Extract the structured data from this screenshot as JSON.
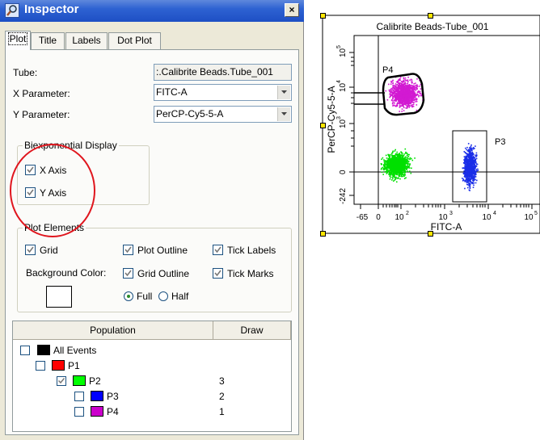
{
  "window": {
    "title": "Inspector",
    "close_glyph": "×",
    "icon": "magnifier-icon"
  },
  "tabs": [
    {
      "label": "Plot",
      "active": true
    },
    {
      "label": "Title",
      "active": false
    },
    {
      "label": "Labels",
      "active": false
    },
    {
      "label": "Dot Plot",
      "active": false
    }
  ],
  "fields": {
    "tube_label": "Tube:",
    "tube_value": ":.Calibrite Beads.Tube_001",
    "x_param_label": "X Parameter:",
    "x_param_value": "FITC-A",
    "y_param_label": "Y Parameter:",
    "y_param_value": "PerCP-Cy5-5-A"
  },
  "biexp": {
    "caption": "Biexponential Display",
    "x_axis": {
      "label": "X Axis",
      "checked": true
    },
    "y_axis": {
      "label": "Y Axis",
      "checked": true
    }
  },
  "plot_elements": {
    "caption": "Plot Elements",
    "grid": {
      "label": "Grid",
      "checked": true
    },
    "plot_outline": {
      "label": "Plot Outline",
      "checked": true
    },
    "tick_labels": {
      "label": "Tick Labels",
      "checked": true
    },
    "background_color_label": "Background Color:",
    "background_color": "#ffffff",
    "grid_outline": {
      "label": "Grid Outline",
      "checked": true
    },
    "tick_marks": {
      "label": "Tick Marks",
      "checked": true
    },
    "full": {
      "label": "Full",
      "selected": true
    },
    "half": {
      "label": "Half",
      "selected": false
    }
  },
  "population_table": {
    "headers": {
      "population": "Population",
      "draw": "Draw"
    },
    "rows": [
      {
        "name": "All Events",
        "color": "#000000",
        "checked": false,
        "draw": ""
      },
      {
        "name": "P1",
        "color": "#ff0000",
        "checked": false,
        "draw": ""
      },
      {
        "name": "P2",
        "color": "#00ff00",
        "checked": true,
        "draw": "3"
      },
      {
        "name": "P3",
        "color": "#0000ff",
        "checked": false,
        "draw": "2"
      },
      {
        "name": "P4",
        "color": "#cc00cc",
        "checked": false,
        "draw": "1"
      }
    ]
  },
  "annotation_color": "#e0161e",
  "plot": {
    "title": "Calibrite Beads-Tube_001",
    "x_label": "FITC-A",
    "y_label": "PerCP-Cy5-5-A",
    "x_ticks": {
      "neg": "-65",
      "zero": "0",
      "t2": "10",
      "t2_exp": "2",
      "t3": "10",
      "t3_exp": "3",
      "t4": "10",
      "t4_exp": "4",
      "t5": "10",
      "t5_exp": "5"
    },
    "y_ticks": {
      "neg": "-242",
      "zero": "0",
      "t3": "10",
      "t3_exp": "3",
      "t4": "10",
      "t4_exp": "4",
      "t5": "10",
      "t5_exp": "5"
    },
    "gates": {
      "p3": "P3",
      "p4": "P4"
    },
    "populations": [
      {
        "name": "P2",
        "color": "#00e000"
      },
      {
        "name": "P3",
        "color": "#1a2ee8"
      },
      {
        "name": "P4",
        "color": "#d21ad2"
      }
    ]
  }
}
